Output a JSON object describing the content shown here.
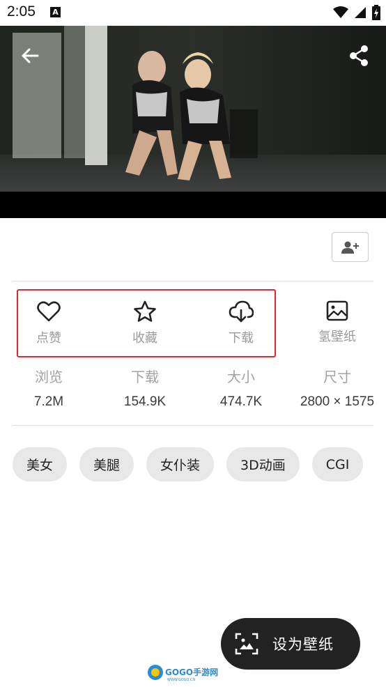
{
  "status_bar": {
    "time": "2:05",
    "icons": [
      "a-notification-icon",
      "wifi-icon",
      "signal-icon",
      "battery-charging-icon"
    ]
  },
  "hero": {
    "image_alt": "",
    "back_icon": "arrow-left-icon",
    "share_icon": "share-icon"
  },
  "follow_button": {
    "icon": "person-add-icon"
  },
  "actions": [
    {
      "label": "点赞",
      "icon": "heart-outline-icon"
    },
    {
      "label": "收藏",
      "icon": "star-outline-icon"
    },
    {
      "label": "下载",
      "icon": "cloud-download-icon"
    },
    {
      "label": "氢壁纸",
      "icon": "image-icon"
    }
  ],
  "stats": [
    {
      "label": "浏览",
      "value": "7.2M"
    },
    {
      "label": "下载",
      "value": "154.9K"
    },
    {
      "label": "大小",
      "value": "474.7K"
    },
    {
      "label": "尺寸",
      "value": "2800 × 1575"
    }
  ],
  "tags": [
    "美女",
    "美腿",
    "女仆装",
    "3D动画",
    "CGI"
  ],
  "fab": {
    "label": "设为壁纸",
    "icon": "set-wallpaper-icon"
  },
  "watermark": "GOGO手游网",
  "colors": {
    "highlight": "#e0262c",
    "fab_bg": "#222222",
    "tag_bg": "#e8e8e8"
  }
}
